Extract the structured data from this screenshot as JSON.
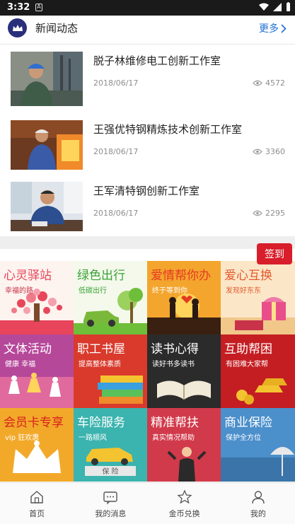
{
  "status_bar": {
    "time": "3:32"
  },
  "news": {
    "title": "新闻动态",
    "more_label": "更多",
    "items": [
      {
        "title": "脱子林维修电工创新工作室",
        "date": "2018/06/17",
        "views": "4572"
      },
      {
        "title": "王强优特钢精炼技术创新工作室",
        "date": "2018/06/17",
        "views": "3360"
      },
      {
        "title": "王军清特钢创新工作室",
        "date": "2018/06/17",
        "views": "2295"
      }
    ]
  },
  "signin_label": "签到",
  "tiles": [
    {
      "title": "心灵驿站",
      "subtitle": "幸福的路",
      "title_color": "#e8465a",
      "sub_color": "#c8334a"
    },
    {
      "title": "绿色出行",
      "subtitle": "低碳出行",
      "title_color": "#3aa135",
      "sub_color": "#3aa135"
    },
    {
      "title": "爱情帮你办",
      "subtitle": "终于等到你",
      "title_color": "#e63a22",
      "sub_color": "#ffffff"
    },
    {
      "title": "爱心互换",
      "subtitle": "发现好东东",
      "title_color": "#e4592e",
      "sub_color": "#e4592e"
    },
    {
      "title": "文体活动",
      "subtitle": "健康 幸福",
      "title_color": "#ffffff",
      "sub_color": "#ffffff"
    },
    {
      "title": "职工书屋",
      "subtitle": "提高整体素质",
      "title_color": "#ffffff",
      "sub_color": "#ffffff"
    },
    {
      "title": "读书心得",
      "subtitle": "读好书多读书",
      "title_color": "#ffffff",
      "sub_color": "#ffffff"
    },
    {
      "title": "互助帮困",
      "subtitle": "有困难大家帮",
      "title_color": "#ffffff",
      "sub_color": "#ffffff"
    },
    {
      "title": "会员卡专享",
      "subtitle": "vip 狂欢惠",
      "title_color": "#d8231c",
      "sub_color": "#ffffff"
    },
    {
      "title": "车险服务",
      "subtitle": "一路顺风",
      "title_color": "#ffffff",
      "sub_color": "#ffffff"
    },
    {
      "title": "精准帮扶",
      "subtitle": "真实情况帮助",
      "title_color": "#ffffff",
      "sub_color": "#ffffff"
    },
    {
      "title": "商业保险",
      "subtitle": "保护全方位",
      "title_color": "#ffffff",
      "sub_color": "#ffffff"
    }
  ],
  "bottom_nav": [
    {
      "label": "首页",
      "icon": "home-icon"
    },
    {
      "label": "我的消息",
      "icon": "message-icon"
    },
    {
      "label": "金币兑换",
      "icon": "star-icon"
    },
    {
      "label": "我的",
      "icon": "user-icon"
    }
  ],
  "colors": {
    "accent": "#1e6fd6",
    "signin_red": "#d81e2a",
    "logo_navy": "#2a2f7a"
  }
}
